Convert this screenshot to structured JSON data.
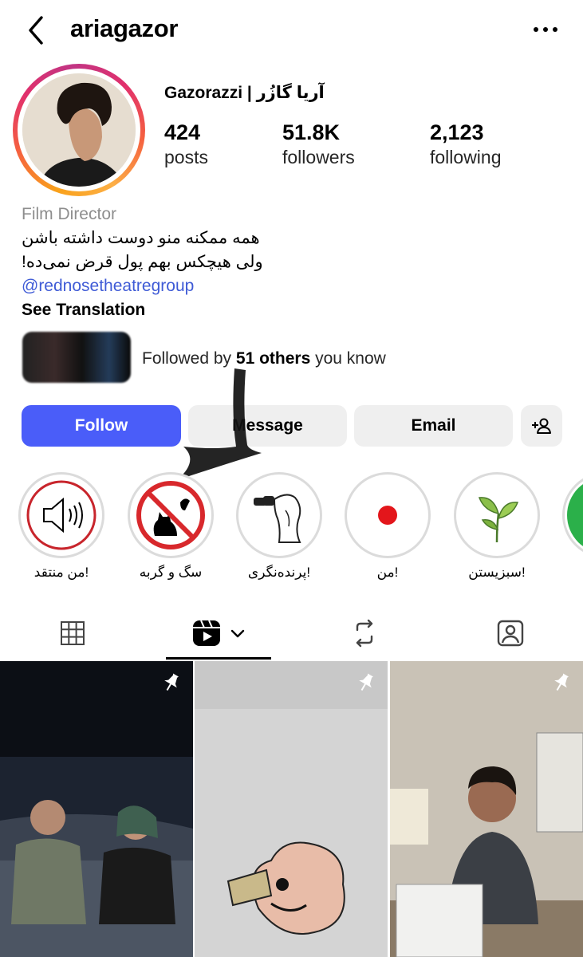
{
  "header": {
    "username": "ariagazor"
  },
  "profile": {
    "display_name": "Gazorazzi | آریا گازُر",
    "stats": [
      {
        "value": "424",
        "label": "posts"
      },
      {
        "value": "51.8K",
        "label": "followers"
      },
      {
        "value": "2,123",
        "label": "following"
      }
    ],
    "category": "Film Director",
    "bio_lines": [
      "همه ممکنه منو دوست داشته باشن",
      "ولی هیچکس بهم پول قرض نمی‌ده!"
    ],
    "link": "@rednosetheatregroup",
    "see_translation": "See Translation",
    "followed_by": {
      "prefix": "Followed by ",
      "count": "51 others",
      "suffix": " you know"
    }
  },
  "actions": {
    "follow": "Follow",
    "message": "Message",
    "email": "Email"
  },
  "highlights": [
    {
      "label": "من منتقد!",
      "icon": "speaker-icon"
    },
    {
      "label": "سگ و گربه",
      "icon": "no-cat-icon"
    },
    {
      "label": "پرنده‌نگری!",
      "icon": "birdwatcher-icon"
    },
    {
      "label": "من!",
      "icon": "red-dot-icon"
    },
    {
      "label": "سبزیستن!",
      "icon": "leaf-icon"
    }
  ],
  "tabs": [
    {
      "name": "grid",
      "icon": "grid-icon"
    },
    {
      "name": "reels",
      "icon": "reels-icon",
      "active": true
    },
    {
      "name": "reposts",
      "icon": "repost-icon"
    },
    {
      "name": "tagged",
      "icon": "tagged-icon"
    }
  ],
  "colors": {
    "follow_button": "#4a5df9",
    "link": "#3f5bd6",
    "secondary_button": "#efefef"
  }
}
